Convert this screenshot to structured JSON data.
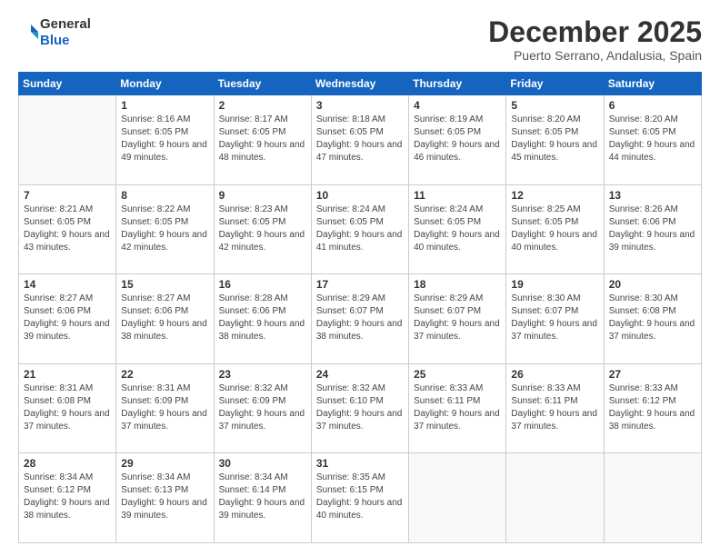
{
  "logo": {
    "general": "General",
    "blue": "Blue"
  },
  "header": {
    "title": "December 2025",
    "subtitle": "Puerto Serrano, Andalusia, Spain"
  },
  "weekdays": [
    "Sunday",
    "Monday",
    "Tuesday",
    "Wednesday",
    "Thursday",
    "Friday",
    "Saturday"
  ],
  "weeks": [
    [
      {
        "day": "",
        "sunrise": "",
        "sunset": "",
        "daylight": ""
      },
      {
        "day": "1",
        "sunrise": "Sunrise: 8:16 AM",
        "sunset": "Sunset: 6:05 PM",
        "daylight": "Daylight: 9 hours and 49 minutes."
      },
      {
        "day": "2",
        "sunrise": "Sunrise: 8:17 AM",
        "sunset": "Sunset: 6:05 PM",
        "daylight": "Daylight: 9 hours and 48 minutes."
      },
      {
        "day": "3",
        "sunrise": "Sunrise: 8:18 AM",
        "sunset": "Sunset: 6:05 PM",
        "daylight": "Daylight: 9 hours and 47 minutes."
      },
      {
        "day": "4",
        "sunrise": "Sunrise: 8:19 AM",
        "sunset": "Sunset: 6:05 PM",
        "daylight": "Daylight: 9 hours and 46 minutes."
      },
      {
        "day": "5",
        "sunrise": "Sunrise: 8:20 AM",
        "sunset": "Sunset: 6:05 PM",
        "daylight": "Daylight: 9 hours and 45 minutes."
      },
      {
        "day": "6",
        "sunrise": "Sunrise: 8:20 AM",
        "sunset": "Sunset: 6:05 PM",
        "daylight": "Daylight: 9 hours and 44 minutes."
      }
    ],
    [
      {
        "day": "7",
        "sunrise": "Sunrise: 8:21 AM",
        "sunset": "Sunset: 6:05 PM",
        "daylight": "Daylight: 9 hours and 43 minutes."
      },
      {
        "day": "8",
        "sunrise": "Sunrise: 8:22 AM",
        "sunset": "Sunset: 6:05 PM",
        "daylight": "Daylight: 9 hours and 42 minutes."
      },
      {
        "day": "9",
        "sunrise": "Sunrise: 8:23 AM",
        "sunset": "Sunset: 6:05 PM",
        "daylight": "Daylight: 9 hours and 42 minutes."
      },
      {
        "day": "10",
        "sunrise": "Sunrise: 8:24 AM",
        "sunset": "Sunset: 6:05 PM",
        "daylight": "Daylight: 9 hours and 41 minutes."
      },
      {
        "day": "11",
        "sunrise": "Sunrise: 8:24 AM",
        "sunset": "Sunset: 6:05 PM",
        "daylight": "Daylight: 9 hours and 40 minutes."
      },
      {
        "day": "12",
        "sunrise": "Sunrise: 8:25 AM",
        "sunset": "Sunset: 6:05 PM",
        "daylight": "Daylight: 9 hours and 40 minutes."
      },
      {
        "day": "13",
        "sunrise": "Sunrise: 8:26 AM",
        "sunset": "Sunset: 6:06 PM",
        "daylight": "Daylight: 9 hours and 39 minutes."
      }
    ],
    [
      {
        "day": "14",
        "sunrise": "Sunrise: 8:27 AM",
        "sunset": "Sunset: 6:06 PM",
        "daylight": "Daylight: 9 hours and 39 minutes."
      },
      {
        "day": "15",
        "sunrise": "Sunrise: 8:27 AM",
        "sunset": "Sunset: 6:06 PM",
        "daylight": "Daylight: 9 hours and 38 minutes."
      },
      {
        "day": "16",
        "sunrise": "Sunrise: 8:28 AM",
        "sunset": "Sunset: 6:06 PM",
        "daylight": "Daylight: 9 hours and 38 minutes."
      },
      {
        "day": "17",
        "sunrise": "Sunrise: 8:29 AM",
        "sunset": "Sunset: 6:07 PM",
        "daylight": "Daylight: 9 hours and 38 minutes."
      },
      {
        "day": "18",
        "sunrise": "Sunrise: 8:29 AM",
        "sunset": "Sunset: 6:07 PM",
        "daylight": "Daylight: 9 hours and 37 minutes."
      },
      {
        "day": "19",
        "sunrise": "Sunrise: 8:30 AM",
        "sunset": "Sunset: 6:07 PM",
        "daylight": "Daylight: 9 hours and 37 minutes."
      },
      {
        "day": "20",
        "sunrise": "Sunrise: 8:30 AM",
        "sunset": "Sunset: 6:08 PM",
        "daylight": "Daylight: 9 hours and 37 minutes."
      }
    ],
    [
      {
        "day": "21",
        "sunrise": "Sunrise: 8:31 AM",
        "sunset": "Sunset: 6:08 PM",
        "daylight": "Daylight: 9 hours and 37 minutes."
      },
      {
        "day": "22",
        "sunrise": "Sunrise: 8:31 AM",
        "sunset": "Sunset: 6:09 PM",
        "daylight": "Daylight: 9 hours and 37 minutes."
      },
      {
        "day": "23",
        "sunrise": "Sunrise: 8:32 AM",
        "sunset": "Sunset: 6:09 PM",
        "daylight": "Daylight: 9 hours and 37 minutes."
      },
      {
        "day": "24",
        "sunrise": "Sunrise: 8:32 AM",
        "sunset": "Sunset: 6:10 PM",
        "daylight": "Daylight: 9 hours and 37 minutes."
      },
      {
        "day": "25",
        "sunrise": "Sunrise: 8:33 AM",
        "sunset": "Sunset: 6:11 PM",
        "daylight": "Daylight: 9 hours and 37 minutes."
      },
      {
        "day": "26",
        "sunrise": "Sunrise: 8:33 AM",
        "sunset": "Sunset: 6:11 PM",
        "daylight": "Daylight: 9 hours and 37 minutes."
      },
      {
        "day": "27",
        "sunrise": "Sunrise: 8:33 AM",
        "sunset": "Sunset: 6:12 PM",
        "daylight": "Daylight: 9 hours and 38 minutes."
      }
    ],
    [
      {
        "day": "28",
        "sunrise": "Sunrise: 8:34 AM",
        "sunset": "Sunset: 6:12 PM",
        "daylight": "Daylight: 9 hours and 38 minutes."
      },
      {
        "day": "29",
        "sunrise": "Sunrise: 8:34 AM",
        "sunset": "Sunset: 6:13 PM",
        "daylight": "Daylight: 9 hours and 39 minutes."
      },
      {
        "day": "30",
        "sunrise": "Sunrise: 8:34 AM",
        "sunset": "Sunset: 6:14 PM",
        "daylight": "Daylight: 9 hours and 39 minutes."
      },
      {
        "day": "31",
        "sunrise": "Sunrise: 8:35 AM",
        "sunset": "Sunset: 6:15 PM",
        "daylight": "Daylight: 9 hours and 40 minutes."
      },
      {
        "day": "",
        "sunrise": "",
        "sunset": "",
        "daylight": ""
      },
      {
        "day": "",
        "sunrise": "",
        "sunset": "",
        "daylight": ""
      },
      {
        "day": "",
        "sunrise": "",
        "sunset": "",
        "daylight": ""
      }
    ]
  ]
}
